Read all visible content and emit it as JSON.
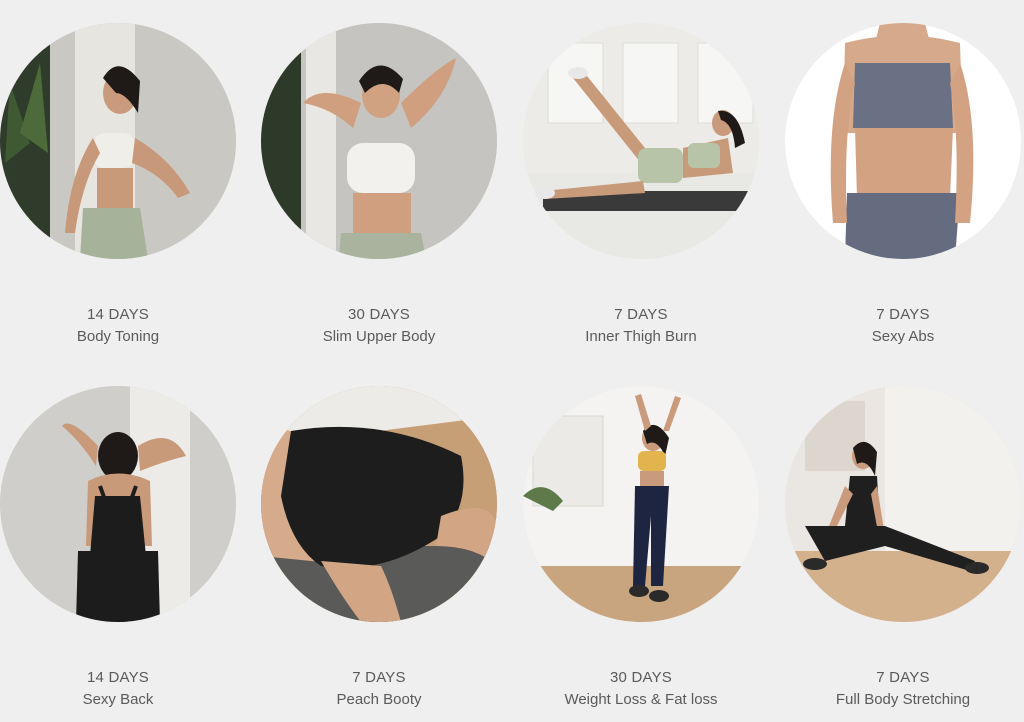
{
  "programs": [
    {
      "days": "14 DAYS",
      "title": "Body Toning",
      "image": "woman-white-sports-bra-sage-leggings-pose"
    },
    {
      "days": "30 DAYS",
      "title": "Slim Upper Body",
      "image": "woman-arms-behind-head-white-bra"
    },
    {
      "days": "7 DAYS",
      "title": "Inner Thigh Burn",
      "image": "woman-side-lying-leg-raise-mat"
    },
    {
      "days": "7 DAYS",
      "title": "Sexy Abs",
      "image": "torso-blue-gray-sports-set"
    },
    {
      "days": "14 DAYS",
      "title": "Sexy Back",
      "image": "woman-back-view-black-bodysuit"
    },
    {
      "days": "7 DAYS",
      "title": "Peach Booty",
      "image": "black-shorts-glute-closeup"
    },
    {
      "days": "30 DAYS",
      "title": "Weight Loss & Fat loss",
      "image": "woman-stretching-arms-up-yellow-top"
    },
    {
      "days": "7 DAYS",
      "title": "Full Body Stretching",
      "image": "woman-side-lunge-stretch-black-outfit"
    }
  ],
  "colors": {
    "background": "#efefef",
    "text": "#5a5a5a"
  }
}
